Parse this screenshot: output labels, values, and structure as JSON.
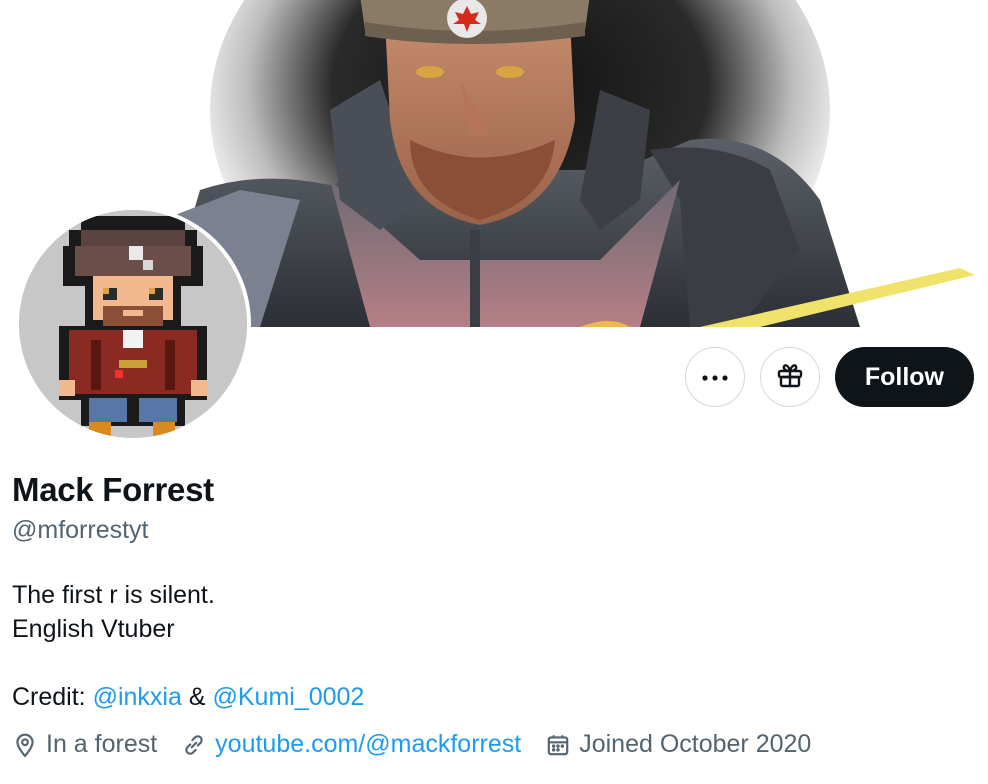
{
  "profile": {
    "display_name": "Mack Forrest",
    "handle": "@mforrestyt",
    "bio_line1": "The first r is silent.",
    "bio_line2": "English Vtuber",
    "credit_label": "Credit:",
    "credit_user1": "@inkxia",
    "credit_amp": "&",
    "credit_user2": "@Kumi_0002"
  },
  "meta": {
    "location": "In a forest",
    "website": "youtube.com/@mackforrest",
    "joined": "Joined October 2020"
  },
  "actions": {
    "follow_label": "Follow",
    "more_icon": "more-icon",
    "gift_icon": "gift-icon"
  },
  "colors": {
    "link": "#1d9bf0",
    "secondary_text": "#536471",
    "primary_text": "#0f1419",
    "follow_bg": "#0f1419"
  }
}
